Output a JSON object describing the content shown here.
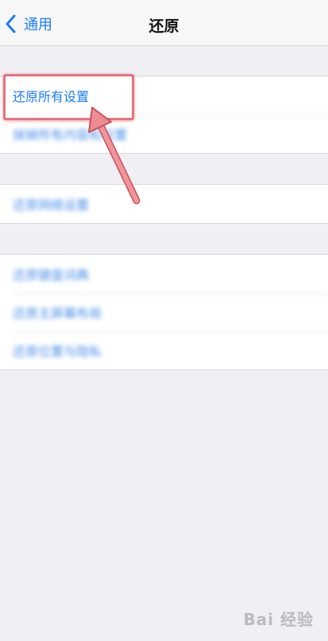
{
  "navbar": {
    "back_label": "通用",
    "title": "还原"
  },
  "groups": [
    {
      "items": [
        "还原所有设置",
        "抹掉所有内容和设置"
      ]
    },
    {
      "items": [
        "还原网络设置"
      ]
    },
    {
      "items": [
        "还原键盘词典",
        "还原主屏幕布局",
        "还原位置与隐私"
      ]
    }
  ],
  "watermark": "Bai 经验",
  "colors": {
    "accent": "#1a7cf5",
    "background": "#efeff4",
    "annotation": "#e8717b"
  }
}
